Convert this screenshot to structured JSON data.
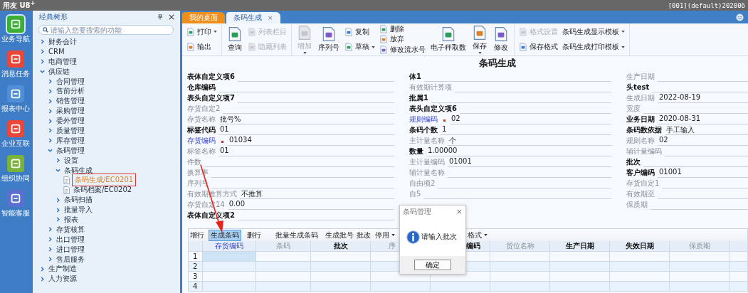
{
  "app_bar": {
    "logo": "用友 U8$^{+}$",
    "account": "[001](default)202006"
  },
  "nav": [
    {
      "label": "业务导航",
      "color": "#3cb034",
      "selected": true
    },
    {
      "label": "消息任务",
      "color": "#e8473a",
      "selected": false
    },
    {
      "label": "报表中心",
      "color": "#4f8fd8",
      "selected": false
    },
    {
      "label": "企业互联",
      "color": "#e8473a",
      "selected": false
    },
    {
      "label": "组织协同",
      "color": "#7ab33a",
      "selected": false
    },
    {
      "label": "智能客服",
      "color": "#5a6fd0",
      "selected": false
    }
  ],
  "sidebar": {
    "title": "经典树形",
    "search_placeholder": "请输入您要搜索的功能",
    "tree": [
      {
        "label": "财务会计",
        "kind": "folder",
        "expanded": false,
        "selected": false
      },
      {
        "label": "CRM",
        "kind": "folder",
        "expanded": false,
        "selected": false
      },
      {
        "label": "电商管理",
        "kind": "folder",
        "expanded": false,
        "selected": false
      },
      {
        "label": "供应链",
        "kind": "folder",
        "expanded": true,
        "selected": false,
        "children": [
          {
            "label": "合同管理",
            "kind": "folder",
            "expanded": false,
            "selected": false
          },
          {
            "label": "售前分析",
            "kind": "folder",
            "expanded": false,
            "selected": false
          },
          {
            "label": "销售管理",
            "kind": "folder",
            "expanded": false,
            "selected": false
          },
          {
            "label": "采购管理",
            "kind": "folder",
            "expanded": false,
            "selected": false
          },
          {
            "label": "委外管理",
            "kind": "folder",
            "expanded": false,
            "selected": false
          },
          {
            "label": "质量管理",
            "kind": "folder",
            "expanded": false,
            "selected": false
          },
          {
            "label": "库存管理",
            "kind": "folder",
            "expanded": false,
            "selected": false
          },
          {
            "label": "条码管理",
            "kind": "folder",
            "expanded": true,
            "selected": false,
            "children": [
              {
                "label": "设置",
                "kind": "folder",
                "expanded": false,
                "selected": false
              },
              {
                "label": "条码生成",
                "kind": "folder",
                "expanded": true,
                "selected": false,
                "children": [
                  {
                    "label": "条码生成/EC0201",
                    "kind": "page",
                    "selected": true
                  },
                  {
                    "label": "条码档案/EC0202",
                    "kind": "page",
                    "selected": false
                  }
                ]
              },
              {
                "label": "条码扫描",
                "kind": "folder",
                "expanded": false,
                "selected": false
              },
              {
                "label": "批量导入",
                "kind": "folder",
                "expanded": false,
                "selected": false
              },
              {
                "label": "报表",
                "kind": "folder",
                "expanded": false,
                "selected": false
              }
            ]
          },
          {
            "label": "存货核算",
            "kind": "folder",
            "expanded": false,
            "selected": false
          },
          {
            "label": "出口管理",
            "kind": "folder",
            "expanded": false,
            "selected": false
          },
          {
            "label": "进口管理",
            "kind": "folder",
            "expanded": false,
            "selected": false
          },
          {
            "label": "售后服务",
            "kind": "folder",
            "expanded": false,
            "selected": false
          }
        ]
      },
      {
        "label": "生产制造",
        "kind": "folder",
        "expanded": false,
        "selected": false
      },
      {
        "label": "人力资源",
        "kind": "folder",
        "expanded": false,
        "selected": false
      }
    ]
  },
  "tabs": [
    {
      "label": "我的桌面",
      "kind": "home",
      "selected": false
    },
    {
      "label": "条码生成",
      "kind": "document",
      "selected": true,
      "close": "×"
    }
  ],
  "toolbar": [
    [
      [
        {
          "label": "打印",
          "kind": "small",
          "disabled": false,
          "menu": true
        },
        {
          "label": "输出",
          "kind": "small",
          "disabled": false,
          "menu": false
        }
      ]
    ],
    [
      [
        {
          "label": "查询",
          "kind": "large",
          "disabled": false,
          "menu": false
        }
      ],
      [
        {
          "label": "列表栏目",
          "kind": "small",
          "disabled": true,
          "menu": false
        },
        {
          "label": "隐藏列表",
          "kind": "small",
          "disabled": true,
          "menu": false
        }
      ]
    ],
    [
      [
        {
          "label": "增加",
          "kind": "large",
          "disabled": true,
          "menu": true
        }
      ],
      [
        {
          "label": "序列号",
          "kind": "large",
          "disabled": false,
          "menu": false
        }
      ],
      [
        {
          "label": "复制",
          "kind": "small",
          "disabled": false,
          "menu": false
        },
        {
          "label": "草稿",
          "kind": "small",
          "disabled": false,
          "menu": true
        }
      ],
      [
        {
          "label": "删除",
          "kind": "small",
          "disabled": false,
          "menu": false
        },
        {
          "label": "放弃",
          "kind": "small",
          "disabled": false,
          "menu": false
        },
        {
          "label": "修改流水号",
          "kind": "small",
          "disabled": false,
          "menu": false
        }
      ],
      [
        {
          "label": "电子秤取数",
          "kind": "large",
          "disabled": false,
          "menu": false
        }
      ],
      [
        {
          "label": "保存",
          "kind": "large",
          "disabled": false,
          "menu": true
        }
      ],
      [
        {
          "label": "修改",
          "kind": "large",
          "disabled": false,
          "menu": false
        }
      ]
    ],
    [
      [
        {
          "label": "格式设置",
          "kind": "small",
          "disabled": true,
          "menu": false
        },
        {
          "label": "保存格式",
          "kind": "small",
          "disabled": false,
          "menu": false
        }
      ],
      [
        {
          "label": "条码生成显示模板",
          "kind": "text",
          "disabled": false,
          "menu": true
        },
        {
          "label": "条码生成打印模板",
          "kind": "text",
          "disabled": false,
          "menu": true
        }
      ]
    ]
  ],
  "form": {
    "title": "条码生成",
    "columns": [
      [
        {
          "label": "表体自定义项6",
          "kind": "bold"
        },
        {
          "label": "仓库编码",
          "kind": "bold"
        },
        {
          "label": "表头自定义项7",
          "kind": "bold"
        },
        {
          "label": "存货自定2",
          "kind": "muted"
        },
        {
          "label": "存货名称",
          "kind": "muted",
          "value": "批号%"
        },
        {
          "label": "标签代码",
          "kind": "bold",
          "value": "01"
        },
        {
          "label": "存货编码",
          "kind": "link",
          "required": true,
          "value": "01034"
        },
        {
          "label": "标签名称",
          "kind": "muted",
          "value": "01"
        },
        {
          "label": "件数",
          "kind": "muted"
        },
        {
          "label": "换算率",
          "kind": "muted"
        },
        {
          "label": "序列号",
          "kind": "muted"
        },
        {
          "label": "有效期推算方式",
          "kind": "muted",
          "value": "不推算"
        },
        {
          "label": "存货自定14",
          "kind": "muted",
          "value": "0.00"
        },
        {
          "label": "表体自定义项2",
          "kind": "bold"
        }
      ],
      [
        {
          "label": "体1",
          "kind": "bold"
        },
        {
          "label": "有效期计算项",
          "kind": "muted"
        },
        {
          "label": "批属1",
          "kind": "bold"
        },
        {
          "label": "表头自定义项6",
          "kind": "bold"
        },
        {
          "label": "规则编码",
          "kind": "link",
          "required": true,
          "value": "02"
        },
        {
          "label": "条码个数",
          "kind": "bold",
          "value": "1"
        },
        {
          "label": "主计量名称",
          "kind": "muted",
          "value": "个"
        },
        {
          "label": "数量",
          "kind": "bold",
          "value": "1.00000"
        },
        {
          "label": "主计量编码",
          "kind": "muted",
          "value": "01001"
        },
        {
          "label": "辅计量名称",
          "kind": "muted"
        },
        {
          "label": "自由项2",
          "kind": "muted"
        },
        {
          "label": "自5",
          "kind": "muted"
        }
      ],
      [
        {
          "label": "生产日期",
          "kind": "muted"
        },
        {
          "label": "头test",
          "kind": "bold"
        },
        {
          "label": "生成日期",
          "kind": "muted",
          "value": "2022-08-19"
        },
        {
          "label": "宽度",
          "kind": "muted"
        },
        {
          "label": "业务日期",
          "kind": "bold",
          "value": "2020-08-31"
        },
        {
          "label": "条码数依据",
          "kind": "bold",
          "value": "手工输入"
        },
        {
          "label": "规则名称",
          "kind": "muted",
          "value": "02"
        },
        {
          "label": "辅计量编码",
          "kind": "muted"
        },
        {
          "label": "批次",
          "kind": "bold"
        },
        {
          "label": "客户编码",
          "kind": "bold",
          "value": "01001"
        },
        {
          "label": "存货自定1",
          "kind": "muted"
        },
        {
          "label": "有效期至",
          "kind": "muted"
        },
        {
          "label": "保质期",
          "kind": "muted"
        }
      ]
    ]
  },
  "grid_toolbar": [
    {
      "label": "增行",
      "selected": false,
      "kind": "button"
    },
    {
      "label": "生成条码",
      "selected": true,
      "kind": "button"
    },
    {
      "label": "删行",
      "selected": false,
      "kind": "button"
    },
    {
      "label": "批量生成条码",
      "selected": false,
      "kind": "button"
    },
    {
      "label": "生成批号",
      "selected": false,
      "kind": "button"
    },
    {
      "label": "批改",
      "selected": false,
      "kind": "button"
    },
    {
      "label": "停用",
      "selected": false,
      "kind": "dropdown"
    },
    {
      "label": "格式",
      "selected": false,
      "kind": "dropdown"
    }
  ],
  "table": {
    "columns": [
      {
        "label": "存货编码",
        "kind": "link"
      },
      {
        "label": "条码",
        "kind": "muted"
      },
      {
        "label": "批次",
        "kind": "bold"
      },
      {
        "label": "序",
        "kind": "muted"
      },
      {
        "label": "编码",
        "kind": "bold"
      },
      {
        "label": "货位名称",
        "kind": "muted"
      },
      {
        "label": "生产日期",
        "kind": "bold"
      },
      {
        "label": "失效日期",
        "kind": "bold"
      },
      {
        "label": "保质期",
        "kind": "muted"
      }
    ],
    "rows": [
      {
        "number": "1",
        "selected": true
      },
      {
        "number": "2",
        "selected": false
      },
      {
        "number": "3",
        "selected": false
      },
      {
        "number": "4",
        "selected": false
      }
    ]
  },
  "dialog": {
    "title": "条码管理",
    "close": "×",
    "message": "请输入批次",
    "button": "确定"
  },
  "annotation": {
    "kind": "arrow"
  }
}
